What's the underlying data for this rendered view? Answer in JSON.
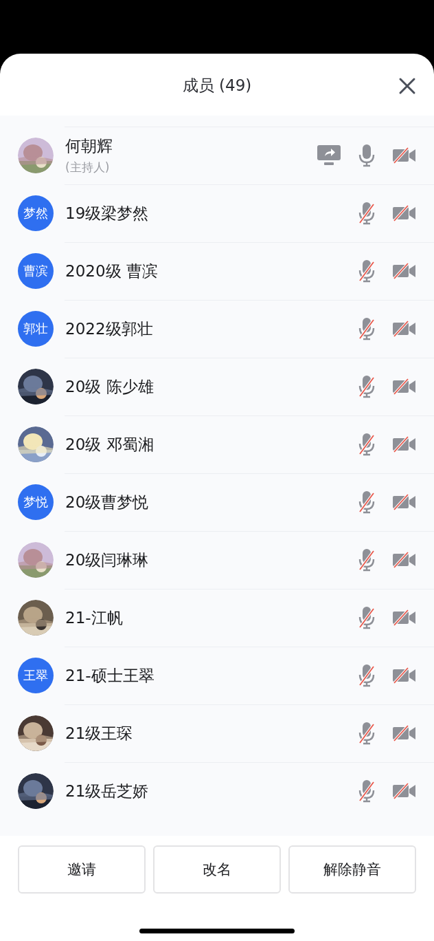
{
  "title": "成员 (49)",
  "members": [
    {
      "name": "何朝辉",
      "role": "(主持人)",
      "sharing": true,
      "mic_muted": false,
      "camera_on": false
    },
    {
      "avatar": {
        "kind": "initials",
        "text": "梦然"
      },
      "name": "19级梁梦然",
      "sharing": false,
      "mic_muted": true,
      "camera_on": false
    },
    {
      "avatar": {
        "kind": "initials",
        "text": "曹滨"
      },
      "name": "2020级 曹滨",
      "sharing": false,
      "mic_muted": true,
      "camera_on": false
    },
    {
      "avatar": {
        "kind": "initials",
        "text": "郭壮"
      },
      "name": "2022级郭壮",
      "sharing": false,
      "mic_muted": true,
      "camera_on": false
    },
    {
      "name": "20级 陈少雄",
      "sharing": false,
      "mic_muted": true,
      "camera_on": false
    },
    {
      "name": "20级 邓蜀湘",
      "sharing": false,
      "mic_muted": true,
      "camera_on": false
    },
    {
      "avatar": {
        "kind": "initials",
        "text": "梦悦"
      },
      "name": "20级曹梦悦",
      "sharing": false,
      "mic_muted": true,
      "camera_on": false
    },
    {
      "name": "20级闫琳琳",
      "sharing": false,
      "mic_muted": true,
      "camera_on": false
    },
    {
      "name": "21-江帆",
      "sharing": false,
      "mic_muted": true,
      "camera_on": false
    },
    {
      "avatar": {
        "kind": "initials",
        "text": "王翠"
      },
      "name": "21-硕士王翠",
      "sharing": false,
      "mic_muted": true,
      "camera_on": false
    },
    {
      "name": "21级王琛",
      "sharing": false,
      "mic_muted": true,
      "camera_on": false
    },
    {
      "name": "21级岳芝娇",
      "sharing": false,
      "mic_muted": true,
      "camera_on": false
    }
  ],
  "buttons": [
    "邀请",
    "改名",
    "解除静音"
  ]
}
